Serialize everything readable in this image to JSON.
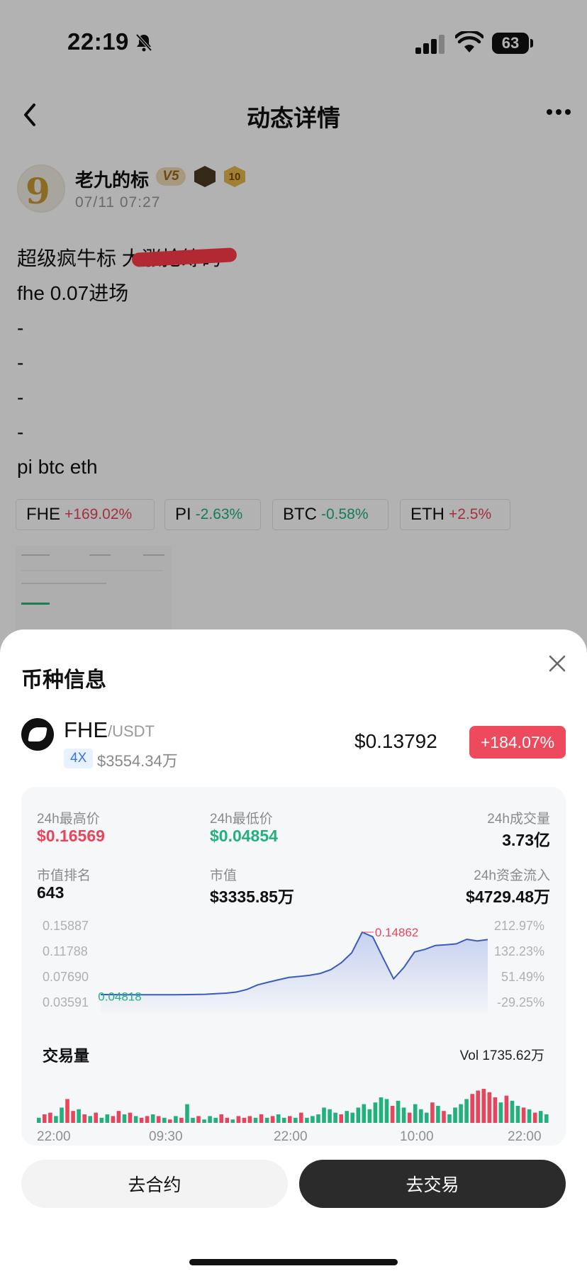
{
  "status_bar": {
    "time": "22:19",
    "battery": "63"
  },
  "nav": {
    "title": "动态详情"
  },
  "post": {
    "author": "老九的标",
    "level": "V5",
    "badge_number": "10",
    "date": "07/11 07:27",
    "lines": [
      "超级疯牛标 大涨抢筹码",
      "fhe 0.07进场",
      "-",
      "-",
      "-",
      "-",
      "pi btc eth"
    ],
    "tags": [
      {
        "symbol": "FHE",
        "change": "+169.02%",
        "dir": "up"
      },
      {
        "symbol": "PI",
        "change": "-2.63%",
        "dir": "down"
      },
      {
        "symbol": "BTC",
        "change": "-0.58%",
        "dir": "down"
      },
      {
        "symbol": "ETH",
        "change": "+2.5%",
        "dir": "up"
      }
    ]
  },
  "sheet": {
    "title": "币种信息",
    "coin": {
      "symbol": "FHE",
      "quote": "/USDT",
      "leverage": "4X",
      "volume": "$3554.34万",
      "price": "$0.13792",
      "change": "+184.07%"
    },
    "stats": {
      "high_label": "24h最高价",
      "high": "$0.16569",
      "low_label": "24h最低价",
      "low": "$0.04854",
      "volume_label": "24h成交量",
      "volume": "3.73亿",
      "rank_label": "市值排名",
      "rank": "643",
      "mcap_label": "市值",
      "mcap": "$3335.85万",
      "inflow_label": "24h资金流入",
      "inflow": "$4729.48万"
    },
    "volume_section": {
      "title": "交易量",
      "total": "Vol 1735.62万"
    },
    "buttons": {
      "contract": "去合约",
      "trade": "去交易"
    }
  },
  "chart_data": {
    "type": "area",
    "y_ticks_left": [
      "0.15887",
      "0.11788",
      "0.07690",
      "0.03591"
    ],
    "y_ticks_right": [
      "212.97%",
      "132.23%",
      "51.49%",
      "-29.25%"
    ],
    "ylim": [
      0.03591,
      0.15887
    ],
    "high_label": "0.14862",
    "low_label": "0.04818",
    "x_ticks": [
      "22:00",
      "09:30",
      "22:00",
      "10:00",
      "22:00"
    ],
    "price": [
      0.0484,
      0.0484,
      0.0482,
      0.0481,
      0.0481,
      0.0481,
      0.0482,
      0.0482,
      0.0483,
      0.0485,
      0.0489,
      0.0498,
      0.0507,
      0.0525,
      0.0568,
      0.064,
      0.0683,
      0.0722,
      0.076,
      0.0776,
      0.0795,
      0.0825,
      0.0885,
      0.0995,
      0.1156,
      0.1486,
      0.1413,
      0.1072,
      0.0737,
      0.0923,
      0.1169,
      0.1211,
      0.1273,
      0.1284,
      0.13,
      0.1372,
      0.1345,
      0.1368
    ],
    "volume": {
      "colors": [
        "up",
        "down"
      ],
      "values": [
        3,
        5,
        6,
        4,
        9,
        14,
        7,
        8,
        5,
        4,
        6,
        3,
        5,
        4,
        7,
        5,
        6,
        4,
        3,
        4,
        5,
        4,
        3,
        2,
        4,
        3,
        11,
        3,
        4,
        2,
        4,
        3,
        5,
        3,
        2,
        4,
        3,
        4,
        3,
        5,
        3,
        4,
        5,
        3,
        4,
        3,
        6,
        3,
        4,
        5,
        9,
        8,
        6,
        5,
        7,
        6,
        9,
        11,
        8,
        12,
        15,
        14,
        10,
        13,
        9,
        6,
        11,
        8,
        6,
        12,
        10,
        7,
        5,
        9,
        11,
        14,
        17,
        19,
        20,
        18,
        15,
        12,
        16,
        13,
        10,
        9,
        8,
        6,
        7,
        5
      ],
      "up_flags": [
        1,
        0,
        0,
        1,
        1,
        0,
        0,
        1,
        0,
        1,
        0,
        1,
        1,
        0,
        0,
        1,
        0,
        1,
        0,
        0,
        1,
        0,
        1,
        0,
        1,
        0,
        1,
        1,
        0,
        1,
        1,
        1,
        0,
        0,
        1,
        0,
        0,
        0,
        1,
        0,
        1,
        0,
        1,
        1,
        0,
        1,
        0,
        1,
        1,
        1,
        1,
        1,
        1,
        0,
        1,
        1,
        1,
        1,
        1,
        1,
        1,
        1,
        0,
        1,
        1,
        0,
        1,
        1,
        1,
        0,
        1,
        0,
        1,
        1,
        1,
        1,
        0,
        0,
        0,
        0,
        0,
        1,
        0,
        1,
        1,
        0,
        1,
        0,
        1,
        1
      ]
    }
  },
  "colors": {
    "up": "#e8455c",
    "down": "#22b07d",
    "line": "#3a5dba",
    "badge": "#ee4a5e"
  }
}
